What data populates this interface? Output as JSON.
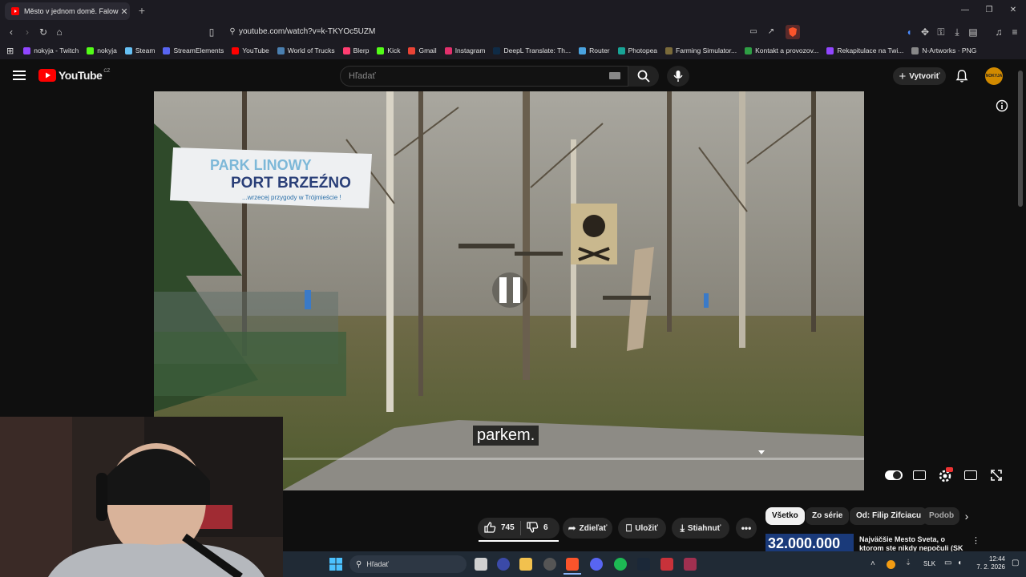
{
  "browser": {
    "tab_title": "Město v jednom domě. Falow",
    "url": "youtube.com/watch?v=k-TKYOc5UZM",
    "bookmarks": [
      {
        "label": "nokyja - Twitch",
        "color": "#9146ff"
      },
      {
        "label": "nokyja",
        "color": "#53fc18"
      },
      {
        "label": "Steam",
        "color": "#1b2838"
      },
      {
        "label": "StreamElements",
        "color": "#5865f2"
      },
      {
        "label": "YouTube",
        "color": "#ff0000"
      },
      {
        "label": "World of Trucks",
        "color": "#4a7fb0"
      },
      {
        "label": "Blerp",
        "color": "#ff3d71"
      },
      {
        "label": "Kick",
        "color": "#53fc18"
      },
      {
        "label": "Gmail",
        "color": "#ea4335"
      },
      {
        "label": "Instagram",
        "color": "#e1306c"
      },
      {
        "label": "DeepL Translate: Th...",
        "color": "#0f2b46"
      },
      {
        "label": "Router",
        "color": "#4aa3df"
      },
      {
        "label": "Photopea",
        "color": "#18a497"
      },
      {
        "label": "Farming Simulator...",
        "color": "#7a6a3a"
      },
      {
        "label": "Kontakt a provozov...",
        "color": "#2e9e44"
      },
      {
        "label": "Rekapitulace na Twi...",
        "color": "#9146ff"
      },
      {
        "label": "N-Artworks · PNG",
        "color": "#888888"
      }
    ]
  },
  "youtube": {
    "logo_text": "YouTube",
    "region": "CZ",
    "search_placeholder": "Hľadať",
    "create_label": "Vytvoriť",
    "avatar_text": "NOKYJA"
  },
  "video": {
    "caption": "parkem.",
    "banner_line1": "PARK LINOWY",
    "banner_line2": "PORT BRZEŹNO",
    "banner_line3": "...wrzecej przygody w Trójmieście !"
  },
  "actions": {
    "likes": "745",
    "dislikes": "6",
    "share": "Zdieľať",
    "save": "Uložiť",
    "download": "Stiahnuť"
  },
  "chips": [
    "Všetko",
    "Zo série",
    "Od: Filip Zifciacu",
    "Podob"
  ],
  "recommendation": {
    "thumb_text": "32.000.000",
    "title": "Najväčšie Mesto Sveta, o ktorom ste nikdy nepočuli (SK"
  },
  "taskbar": {
    "search_label": "Hľadať",
    "language": "SLK",
    "time": "12:44",
    "date": "7. 2. 2026"
  }
}
